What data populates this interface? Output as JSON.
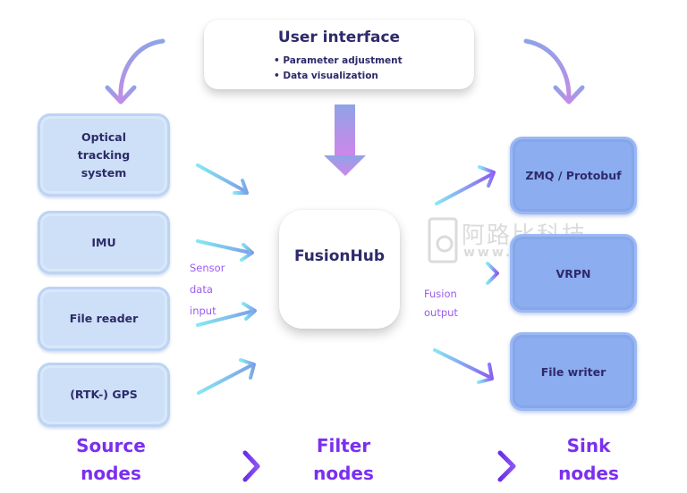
{
  "user_interface": {
    "title": "User interface",
    "items": [
      "Parameter adjustment",
      "Data visualization"
    ]
  },
  "source_nodes": [
    {
      "label": "Optical tracking system"
    },
    {
      "label": "IMU"
    },
    {
      "label": "File reader"
    },
    {
      "label": "(RTK-) GPS"
    }
  ],
  "filter_node": {
    "label": "FusionHub"
  },
  "sink_nodes": [
    {
      "label": "ZMQ / Protobuf"
    },
    {
      "label": "VRPN"
    },
    {
      "label": "File writer"
    }
  ],
  "captions": {
    "sensor_input": [
      "Sensor",
      "data",
      "input"
    ],
    "fusion_output": [
      "Fusion",
      "output"
    ]
  },
  "columns": {
    "source": [
      "Source",
      "nodes"
    ],
    "filter": [
      "Filter",
      "nodes"
    ],
    "sink": [
      "Sink",
      "nodes"
    ]
  },
  "watermark": {
    "cn": "阿路比科技",
    "url": "www.alubi.cn"
  },
  "colors": {
    "text_dark": "#2e2a6a",
    "accent_purple": "#7b2ff0",
    "source_fill": "#cde0f7",
    "sink_fill": "#8cadf0",
    "arrow_cyan": "#7fe3f0",
    "arrow_violet": "#b98ae6"
  }
}
